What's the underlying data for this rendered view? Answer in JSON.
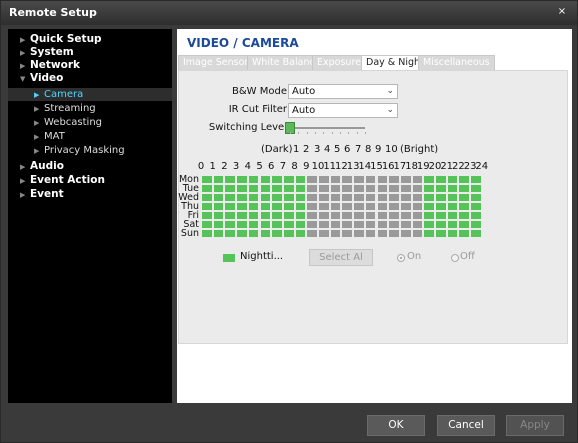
{
  "window": {
    "title": "Remote Setup",
    "close_glyph": "×"
  },
  "sidebar": {
    "items": [
      {
        "label": "Quick Setup",
        "level": "top"
      },
      {
        "label": "System",
        "level": "top"
      },
      {
        "label": "Network",
        "level": "top"
      },
      {
        "label": "Video",
        "level": "top",
        "expanded": true
      },
      {
        "label": "Camera",
        "level": "sub",
        "selected": true
      },
      {
        "label": "Streaming",
        "level": "sub"
      },
      {
        "label": "Webcasting",
        "level": "sub"
      },
      {
        "label": "MAT",
        "level": "sub"
      },
      {
        "label": "Privacy Masking",
        "level": "sub"
      },
      {
        "label": "Audio",
        "level": "top"
      },
      {
        "label": "Event Action",
        "level": "top"
      },
      {
        "label": "Event",
        "level": "top"
      }
    ]
  },
  "page": {
    "title": "VIDEO / CAMERA",
    "tabs": [
      {
        "label": "Image Sensor",
        "active": false
      },
      {
        "label": "White Balance",
        "active": false
      },
      {
        "label": "Exposure",
        "active": false
      },
      {
        "label": "Day & Night",
        "active": true
      },
      {
        "label": "Miscellaneous",
        "active": false
      }
    ]
  },
  "daynight": {
    "bw_mode_label": "B&W Mode",
    "bw_mode_value": "Auto",
    "ir_cut_label": "IR Cut Filter",
    "ir_cut_value": "Auto",
    "switching_level_label": "Switching Level",
    "switching_level_value": 1,
    "scale_dark": "(Dark)",
    "scale_bright": "(Bright)",
    "scale_numbers": [
      "1",
      "2",
      "3",
      "4",
      "5",
      "6",
      "7",
      "8",
      "9",
      "10"
    ],
    "hours": [
      "0",
      "1",
      "2",
      "3",
      "4",
      "5",
      "6",
      "7",
      "8",
      "9",
      "10",
      "11",
      "12",
      "13",
      "14",
      "15",
      "16",
      "17",
      "18",
      "19",
      "20",
      "21",
      "22",
      "23",
      "24"
    ],
    "days": [
      "Mon",
      "Tue",
      "Wed",
      "Thu",
      "Fri",
      "Sat",
      "Sun"
    ],
    "night_hours": [
      0,
      1,
      2,
      3,
      4,
      5,
      6,
      7,
      8,
      19,
      20,
      21,
      22,
      23
    ],
    "legend_label": "Nightti...",
    "select_all_label": "Select Al",
    "radio_on_label": "On",
    "radio_off_label": "Off",
    "radio_selected": "On",
    "colors": {
      "night": "#55c35a",
      "day": "#9a9a9a"
    }
  },
  "footer": {
    "ok_label": "OK",
    "cancel_label": "Cancel",
    "apply_label": "Apply"
  }
}
